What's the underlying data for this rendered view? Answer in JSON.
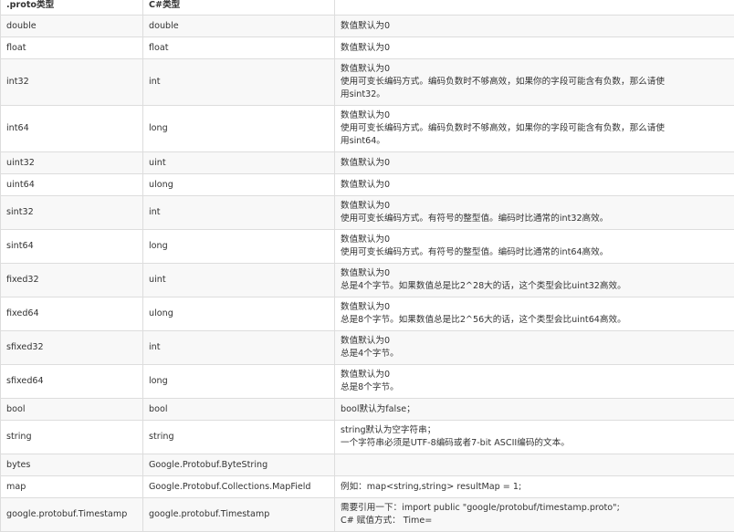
{
  "table": {
    "headers": [
      ".proto类型",
      "C#类型",
      ""
    ],
    "rows": [
      {
        "proto": "double",
        "csharp": "double",
        "notes": [
          "数值默认为0"
        ]
      },
      {
        "proto": "float",
        "csharp": "float",
        "notes": [
          "数值默认为0"
        ]
      },
      {
        "proto": "int32",
        "csharp": "int",
        "notes": [
          "数值默认为0",
          "使用可变长编码方式。编码负数时不够高效，如果你的字段可能含有负数，那么请使",
          "用sint32。"
        ]
      },
      {
        "proto": "int64",
        "csharp": "long",
        "notes": [
          "数值默认为0",
          "使用可变长编码方式。编码负数时不够高效，如果你的字段可能含有负数，那么请使",
          "用sint64。"
        ]
      },
      {
        "proto": "uint32",
        "csharp": "uint",
        "notes": [
          "数值默认为0"
        ]
      },
      {
        "proto": "uint64",
        "csharp": "ulong",
        "notes": [
          "数值默认为0"
        ]
      },
      {
        "proto": "sint32",
        "csharp": "int",
        "notes": [
          "数值默认为0",
          "使用可变长编码方式。有符号的整型值。编码时比通常的int32高效。"
        ]
      },
      {
        "proto": "sint64",
        "csharp": "long",
        "notes": [
          "数值默认为0",
          "使用可变长编码方式。有符号的整型值。编码时比通常的int64高效。"
        ]
      },
      {
        "proto": "fixed32",
        "csharp": "uint",
        "notes": [
          "数值默认为0",
          "总是4个字节。如果数值总是比2^28大的话，这个类型会比uint32高效。"
        ]
      },
      {
        "proto": "fixed64",
        "csharp": "ulong",
        "notes": [
          "数值默认为0",
          "总是8个字节。如果数值总是比2^56大的话，这个类型会比uint64高效。"
        ]
      },
      {
        "proto": "sfixed32",
        "csharp": "int",
        "notes": [
          "数值默认为0",
          "总是4个字节。"
        ]
      },
      {
        "proto": "sfixed64",
        "csharp": "long",
        "notes": [
          "数值默认为0",
          "总是8个字节。"
        ]
      },
      {
        "proto": "bool",
        "csharp": "bool",
        "notes": [
          "bool默认为false；"
        ]
      },
      {
        "proto": "string",
        "csharp": "string",
        "notes": [
          "string默认为空字符串；",
          "一个字符串必须是UTF-8编码或者7-bit ASCII编码的文本。"
        ]
      },
      {
        "proto": "bytes",
        "csharp": "Google.Protobuf.ByteString",
        "notes": [
          ""
        ]
      },
      {
        "proto": "map",
        "csharp": "Google.Protobuf.Collections.MapField",
        "notes": [
          "例如：map<string,string> resultMap = 1;"
        ]
      },
      {
        "proto": "google.protobuf.Timestamp",
        "csharp": "google.protobuf.Timestamp",
        "notes": [
          "需要引用一下：import public \"google/protobuf/timestamp.proto\";",
          "C# 赋值方式： Time="
        ]
      }
    ]
  }
}
